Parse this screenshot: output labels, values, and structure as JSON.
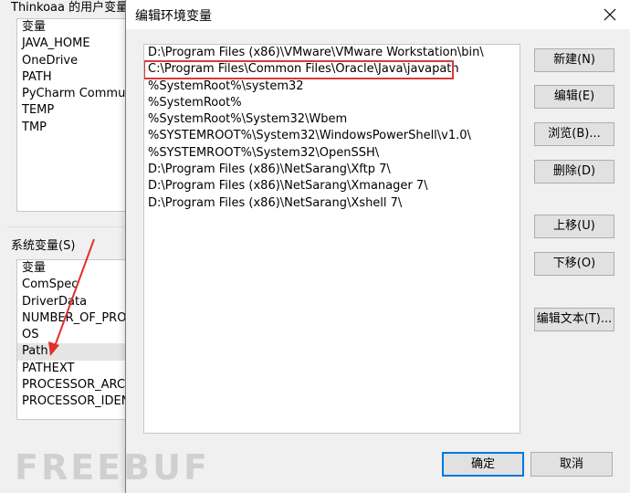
{
  "background_dialog": {
    "user_vars_title": "Thinkoaa 的用户变量(U)",
    "user_vars": {
      "header": "变量",
      "items": [
        "JAVA_HOME",
        "OneDrive",
        "PATH",
        "PyCharm Community Edition",
        "TEMP",
        "TMP"
      ]
    },
    "system_vars_label": "系统变量(S)",
    "system_vars": {
      "header": "变量",
      "items": [
        "ComSpec",
        "DriverData",
        "NUMBER_OF_PROCESSORS",
        "OS",
        "Path",
        "PATHEXT",
        "PROCESSOR_ARCHITECTURE",
        "PROCESSOR_IDENTIFIER"
      ],
      "highlighted": "Path"
    }
  },
  "dialog": {
    "title": "编辑环境变量",
    "paths": [
      "D:\\Program Files (x86)\\VMware\\VMware Workstation\\bin\\",
      "C:\\Program Files\\Common Files\\Oracle\\Java\\javapath",
      "%SystemRoot%\\system32",
      "%SystemRoot%",
      "%SystemRoot%\\System32\\Wbem",
      "%SYSTEMROOT%\\System32\\WindowsPowerShell\\v1.0\\",
      "%SYSTEMROOT%\\System32\\OpenSSH\\",
      "D:\\Program Files (x86)\\NetSarang\\Xftp 7\\",
      "D:\\Program Files (x86)\\NetSarang\\Xmanager 7\\",
      "D:\\Program Files (x86)\\NetSarang\\Xshell 7\\"
    ],
    "highlighted_path": "C:\\Program Files\\Common Files\\Oracle\\Java\\javapath",
    "buttons": {
      "new": "新建(N)",
      "edit": "编辑(E)",
      "browse": "浏览(B)...",
      "delete": "删除(D)",
      "move_up": "上移(U)",
      "move_down": "下移(O)",
      "edit_text": "编辑文本(T)...",
      "ok": "确定",
      "cancel": "取消"
    }
  },
  "annotation": {
    "highlight_color": "#d9383b",
    "arrow_color": "#e0302c"
  },
  "watermark": "FREEBUF"
}
